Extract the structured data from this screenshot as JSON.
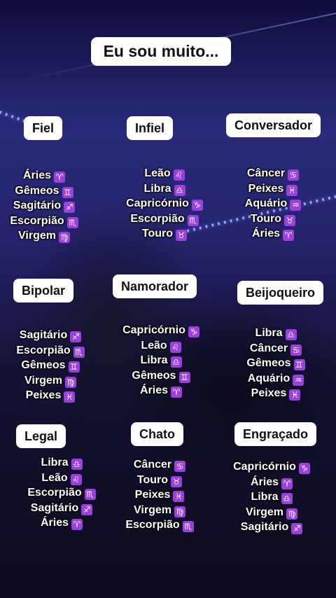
{
  "title": "Eu sou muito...",
  "sign_color": "#9b3fe0",
  "symbols": {
    "Áries": "♈",
    "Touro": "♉",
    "Gêmeos": "♊",
    "Câncer": "♋",
    "Leão": "♌",
    "Virgem": "♍",
    "Libra": "♎",
    "Escorpião": "♏",
    "Sagitário": "♐",
    "Capricórnio": "♑",
    "Aquário": "♒",
    "Peixes": "♓"
  },
  "categories": [
    {
      "label": "Fiel",
      "signs": [
        "Áries",
        "Gêmeos",
        "Sagitário",
        "Escorpião",
        "Virgem"
      ]
    },
    {
      "label": "Infiel",
      "signs": [
        "Leão",
        "Libra",
        "Capricórnio",
        "Escorpião",
        "Touro"
      ]
    },
    {
      "label": "Conversador",
      "signs": [
        "Câncer",
        "Peixes",
        "Aquário",
        "Touro",
        "Áries"
      ]
    },
    {
      "label": "Bipolar",
      "signs": [
        "Sagitário",
        "Escorpião",
        "Gêmeos",
        "Virgem",
        "Peixes"
      ]
    },
    {
      "label": "Namorador",
      "signs": [
        "Capricórnio",
        "Leão",
        "Libra",
        "Gêmeos",
        "Áries"
      ]
    },
    {
      "label": "Beijoqueiro",
      "signs": [
        "Libra",
        "Câncer",
        "Gêmeos",
        "Aquário",
        "Peixes"
      ]
    },
    {
      "label": "Legal",
      "signs": [
        "Libra",
        "Leão",
        "Escorpião",
        "Sagitário",
        "Áries"
      ]
    },
    {
      "label": "Chato",
      "signs": [
        "Câncer",
        "Touro",
        "Peixes",
        "Virgem",
        "Escorpião"
      ]
    },
    {
      "label": "Engraçado",
      "signs": [
        "Capricórnio",
        "Áries",
        "Libra",
        "Virgem",
        "Sagitário"
      ]
    }
  ]
}
